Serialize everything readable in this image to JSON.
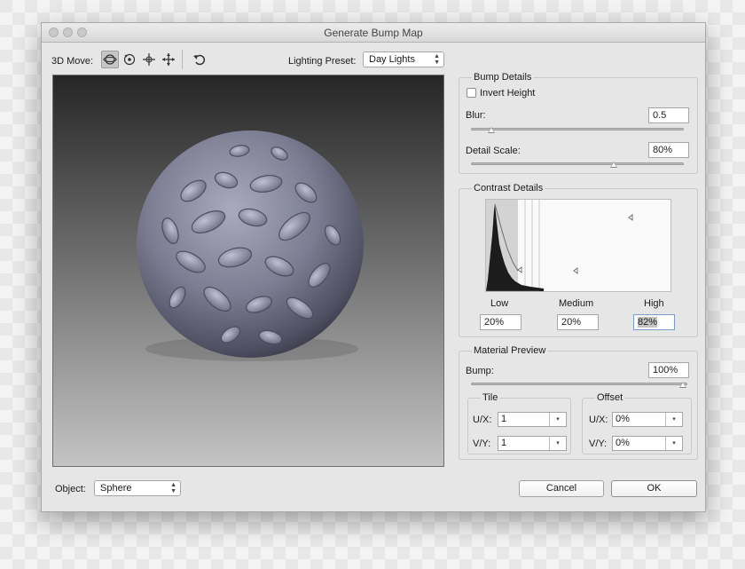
{
  "window": {
    "title": "Generate Bump Map"
  },
  "toolbar": {
    "move_label": "3D Move:",
    "lighting_label": "Lighting Preset:",
    "lighting_value": "Day Lights",
    "tools": [
      "rotate-light-icon",
      "roll-icon",
      "pan-icon",
      "slide-icon",
      "reset-view-icon"
    ]
  },
  "bump_details": {
    "title": "Bump Details",
    "invert_label": "Invert Height",
    "invert_checked": false,
    "blur_label": "Blur:",
    "blur_value": "0.5",
    "blur_position": 0.1,
    "detail_label": "Detail Scale:",
    "detail_value": "80%",
    "detail_position": 0.67
  },
  "contrast_details": {
    "title": "Contrast Details",
    "low_label": "Low",
    "medium_label": "Medium",
    "high_label": "High",
    "low_value": "20%",
    "medium_value": "20%",
    "high_value": "82%"
  },
  "material_preview": {
    "title": "Material Preview",
    "bump_label": "Bump:",
    "bump_value": "100%",
    "bump_position": 1.0,
    "tile": {
      "title": "Tile",
      "ux_label": "U/X:",
      "ux_value": "1",
      "vy_label": "V/Y:",
      "vy_value": "1"
    },
    "offset": {
      "title": "Offset",
      "ux_label": "U/X:",
      "ux_value": "0%",
      "vy_label": "V/Y:",
      "vy_value": "0%"
    }
  },
  "footer": {
    "object_label": "Object:",
    "object_value": "Sphere",
    "cancel_label": "Cancel",
    "ok_label": "OK"
  }
}
